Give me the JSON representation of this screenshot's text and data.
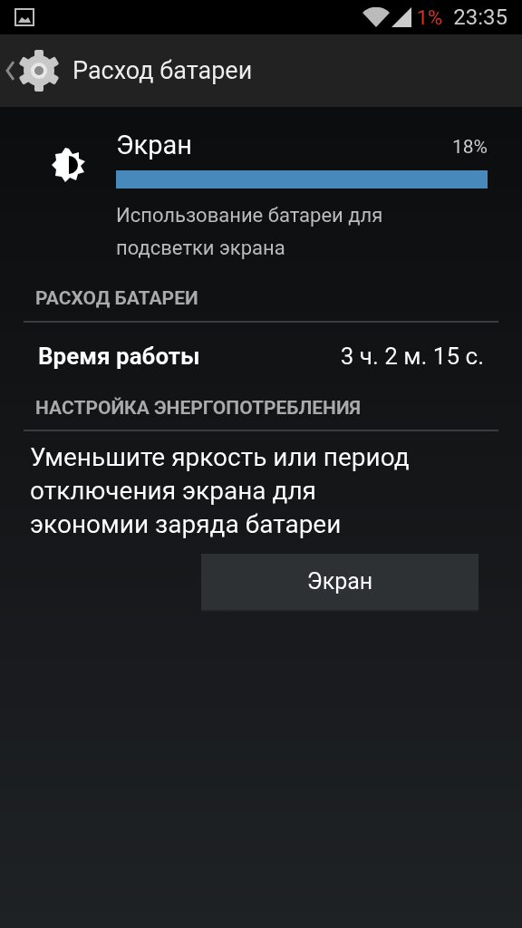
{
  "status_bar": {
    "battery_text": "1%",
    "time": "23:35"
  },
  "action_bar": {
    "title": "Расход батареи"
  },
  "usage_item": {
    "title": "Экран",
    "percent": "18%",
    "level": 1,
    "description": "Использование батареи для подсветки экрана"
  },
  "sections": [
    {
      "header": "РАСХОД БАТАРЕИ",
      "rows": [
        {
          "label": "Время работы",
          "value": "3 ч. 2 м. 15 с."
        }
      ]
    },
    {
      "header": "НАСТРОЙКА ЭНЕРГОПОТРЕБЛЕНИЯ",
      "text": "Уменьшите яркость или период отключения экрана для экономии заряда батареи",
      "button": "Экран"
    }
  ]
}
